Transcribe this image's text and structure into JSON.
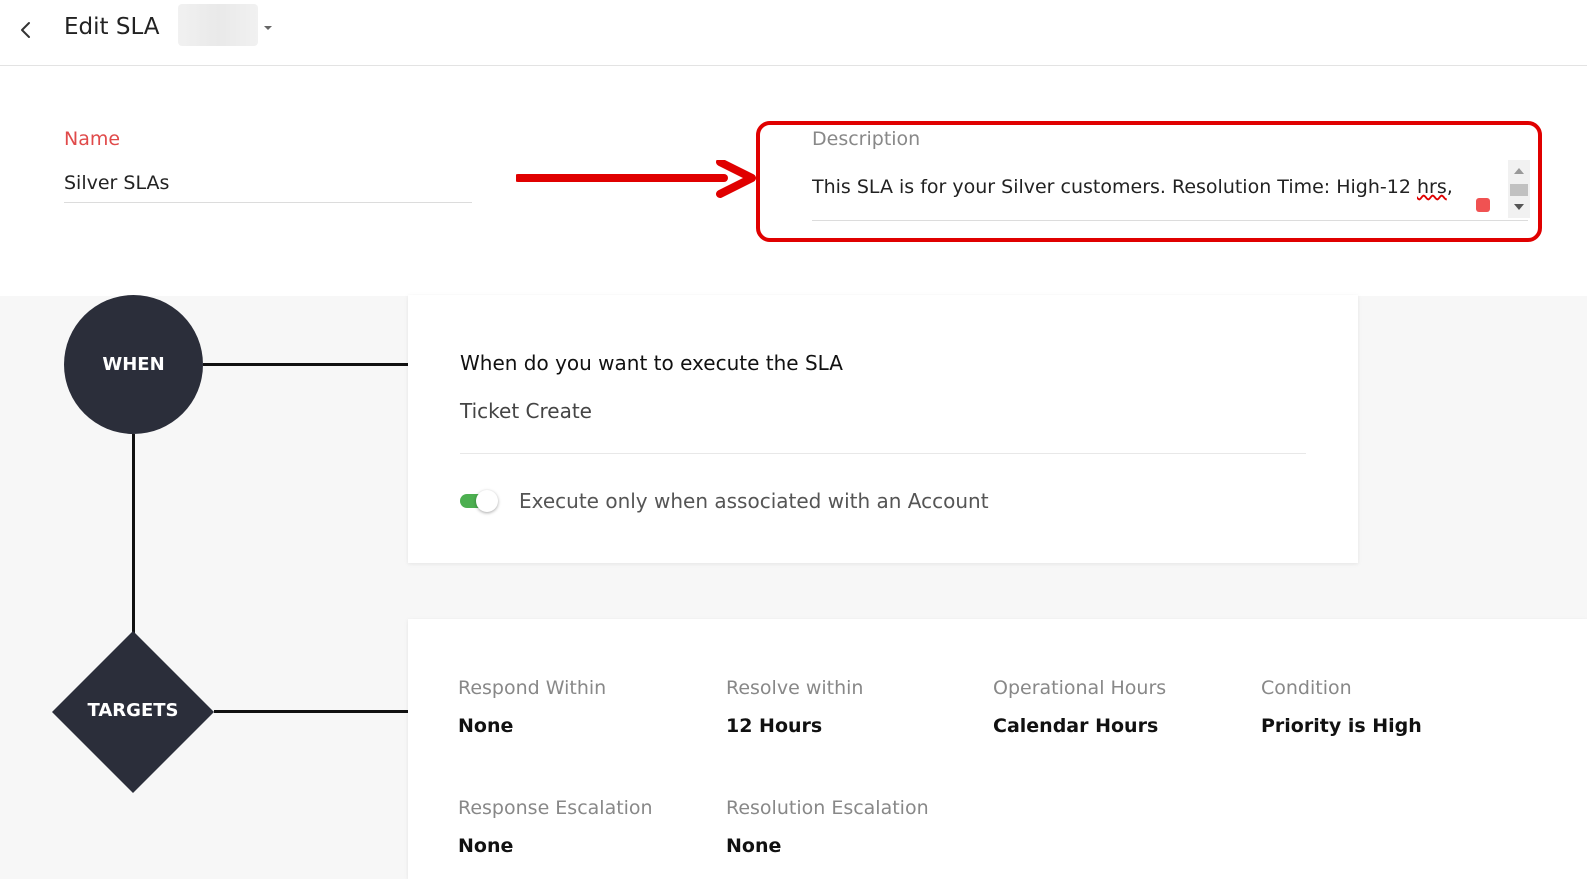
{
  "header": {
    "back_icon": "chevron-left-icon",
    "title": "Edit SLA",
    "sla_selector_caret_icon": "caret-down-icon"
  },
  "form": {
    "name_label": "Name",
    "name_value": "Silver SLAs",
    "description_label": "Description",
    "description_value_prefix": "This SLA is for your Silver customers. Resolution Time: High-12 ",
    "description_value_misspelled": "hrs",
    "description_value_suffix": ","
  },
  "colors": {
    "name_label": "#e04a4a",
    "highlight": "#e00000",
    "node_fill": "#2b2e3a",
    "toggle_on": "#4caf50"
  },
  "flow": {
    "when_node_label": "WHEN",
    "targets_node_label": "TARGETS"
  },
  "when_card": {
    "question": "When do you want to execute the SLA",
    "trigger": "Ticket Create",
    "toggle_state": "on",
    "toggle_label": "Execute only when associated with an Account"
  },
  "targets_card": {
    "items": [
      {
        "label": "Respond Within",
        "value": "None"
      },
      {
        "label": "Resolve within",
        "value": "12 Hours"
      },
      {
        "label": "Operational Hours",
        "value": "Calendar Hours"
      },
      {
        "label": "Condition",
        "value": "Priority is High"
      },
      {
        "label": "Response Escalation",
        "value": "None"
      },
      {
        "label": "Resolution Escalation",
        "value": "None"
      }
    ]
  }
}
